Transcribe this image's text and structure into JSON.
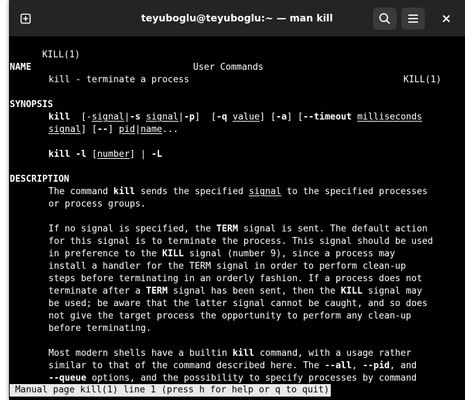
{
  "window": {
    "title": "teyuboglu@teyuboglu:~ — man kill",
    "new_tab_icon": "plus-square-icon",
    "search_icon": "search-icon",
    "menu_icon": "hamburger-menu-icon",
    "close_icon": "close-icon"
  },
  "colors": {
    "titlebar_bg": "#242424",
    "terminal_bg": "#000000",
    "terminal_fg": "#ffffff",
    "status_bg": "#e9e9e9"
  },
  "man": {
    "header_left": "KILL(1)",
    "header_center": "User Commands",
    "header_right": "KILL(1)",
    "name_heading": "NAME",
    "name_text": "kill - terminate a process",
    "synopsis_heading": "SYNOPSIS",
    "syn1": {
      "cmd": "kill",
      "p1": "  [",
      "dash1": "-",
      "signal1": "signal",
      "pipe1": "|",
      "opt_s": "-s",
      "sp1": " ",
      "signal2": "signal",
      "pipe2": "|",
      "opt_p": "-p",
      "p2": "]  [",
      "opt_q": "-q",
      "sp2": " ",
      "value": "value",
      "p3": "] [",
      "opt_a": "-a",
      "p4": "] [",
      "opt_timeout": "--timeout",
      "sp3": " ",
      "milliseconds": "milliseconds"
    },
    "syn2": {
      "signal": "signal",
      "p1": "] [",
      "dashdash": "--",
      "p2": "] ",
      "pid": "pid",
      "pipe": "|",
      "name": "name",
      "ellipsis": "..."
    },
    "syn3": {
      "cmd": "kill",
      "sp": " ",
      "opt_l": "-l",
      "p1": " [",
      "number": "number",
      "p2": "] | ",
      "opt_L": "-L"
    },
    "description_heading": "DESCRIPTION",
    "d1": {
      "a": "The command ",
      "kill": "kill",
      "b": " sends the specified ",
      "signal": "signal",
      "c": " to the specified processes"
    },
    "d2": "or process groups.",
    "d3": {
      "a": "If no signal is specified, the ",
      "term": "TERM",
      "b": " signal is sent. The default action"
    },
    "d4": "for this signal is to terminate the process. This signal should be used",
    "d5": {
      "a": "in preference to the ",
      "kill": "KILL",
      "b": " signal (number 9), since a process may"
    },
    "d6": "install a handler for the TERM signal in order to perform clean-up",
    "d7": "steps before terminating in an orderly fashion. If a process does not",
    "d8": {
      "a": "terminate after a ",
      "term": "TERM",
      "b": " signal has been sent, then the ",
      "kill": "KILL",
      "c": " signal may"
    },
    "d9": "be used; be aware that the latter signal cannot be caught, and so does",
    "d10": "not give the target process the opportunity to perform any clean-up",
    "d11": "before terminating.",
    "d12": {
      "a": "Most modern shells have a builtin ",
      "kill": "kill",
      "b": " command, with a usage rather"
    },
    "d13": {
      "a": "similar to that of the command described here. The ",
      "all": "--all",
      "b": ", ",
      "pid": "--pid",
      "c": ", and"
    },
    "d14": {
      "queue": "--queue",
      "a": " options, and the possibility to specify processes by command"
    },
    "status": " Manual page kill(1) line 1 (press h for help or q to quit)"
  }
}
